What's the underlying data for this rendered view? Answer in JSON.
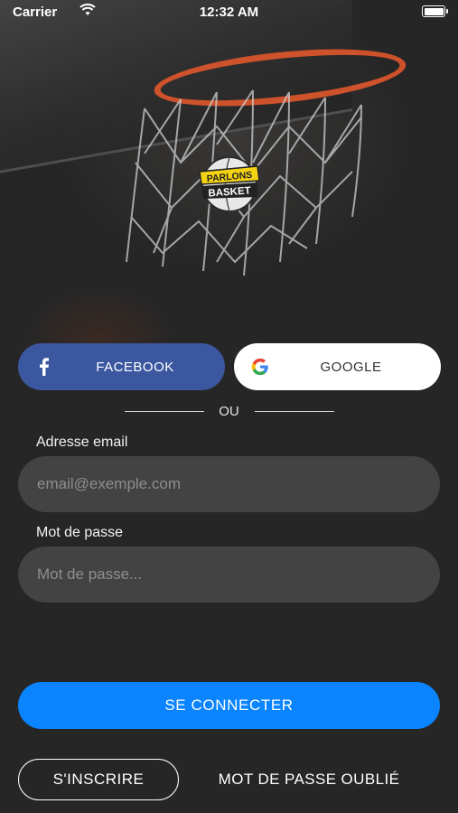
{
  "status_bar": {
    "carrier": "Carrier",
    "time": "12:32 AM"
  },
  "logo": {
    "line1": "PARLONS",
    "line2": "BASKET"
  },
  "social": {
    "facebook_label": "FACEBOOK",
    "google_label": "GOOGLE"
  },
  "divider": {
    "text": "OU"
  },
  "form": {
    "email_label": "Adresse email",
    "email_placeholder": "email@exemple.com",
    "email_value": "",
    "password_label": "Mot de passe",
    "password_placeholder": "Mot de passe...",
    "password_value": ""
  },
  "actions": {
    "login_label": "SE CONNECTER",
    "signup_label": "S'INSCRIRE",
    "forgot_label": "MOT DE PASSE OUBLIÉ"
  },
  "colors": {
    "background": "#262626",
    "facebook": "#3b57a0",
    "primary": "#0a84ff",
    "input_bg": "#434343",
    "logo_yellow": "#f5d312"
  },
  "icons": [
    "wifi-icon",
    "battery-icon",
    "facebook-icon",
    "google-icon"
  ]
}
